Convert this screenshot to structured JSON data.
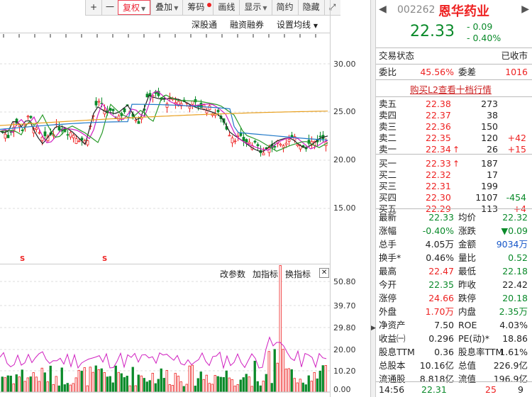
{
  "toolbar": {
    "items": [
      "+",
      "一",
      "复权",
      "叠加",
      "筹码",
      "画线",
      "显示",
      "简约",
      "隐藏"
    ],
    "expand_icon": "expand-icon"
  },
  "subbar": {
    "items": [
      "深股通",
      "融资融券",
      "设置均线"
    ]
  },
  "price_axis": {
    "labels": [
      "30.00",
      "25.00",
      "20.00",
      "15.00"
    ]
  },
  "volume": {
    "toolbar": [
      "改参数",
      "加指标",
      "换指标"
    ],
    "axis_labels": [
      "50.80",
      "39.70",
      "29.80",
      "20.00",
      "10.20",
      "0.00"
    ]
  },
  "markers": [
    "S",
    "S"
  ],
  "stock": {
    "code": "002262",
    "name": "恩华药业",
    "price": "22.33",
    "change": "- 0.09",
    "change_pct": "- 0.40%"
  },
  "status": {
    "label": "交易状态",
    "value": "已收市"
  },
  "ratio": {
    "k1": "委比",
    "v1": "45.56%",
    "k2": "委差",
    "v2": "1016"
  },
  "l2_link": "购买L2查看十档行情",
  "asks": [
    {
      "label": "卖五",
      "price": "22.38",
      "vol": "273",
      "chg": ""
    },
    {
      "label": "卖四",
      "price": "22.37",
      "vol": "38",
      "chg": ""
    },
    {
      "label": "卖三",
      "price": "22.36",
      "vol": "150",
      "chg": ""
    },
    {
      "label": "卖二",
      "price": "22.35",
      "vol": "120",
      "chg": "+42"
    },
    {
      "label": "卖一",
      "price": "22.34",
      "vol": "26",
      "chg": "+15"
    }
  ],
  "bids": [
    {
      "label": "买一",
      "price": "22.33",
      "vol": "187",
      "chg": ""
    },
    {
      "label": "买二",
      "price": "22.32",
      "vol": "17",
      "chg": ""
    },
    {
      "label": "买三",
      "price": "22.31",
      "vol": "199",
      "chg": ""
    },
    {
      "label": "买四",
      "price": "22.30",
      "vol": "1107",
      "chg": "-454"
    },
    {
      "label": "买五",
      "price": "22.29",
      "vol": "113",
      "chg": "+4"
    }
  ],
  "stats": [
    {
      "k1": "最新",
      "v1": "22.33",
      "c1": "green",
      "k2": "均价",
      "v2": "22.32",
      "c2": "green"
    },
    {
      "k1": "涨幅",
      "v1": "-0.40%",
      "c1": "green",
      "k2": "涨跌",
      "v2": "▼0.09",
      "c2": "green"
    },
    {
      "k1": "总手",
      "v1": "4.05万",
      "c1": "",
      "k2": "金额",
      "v2": "9034万",
      "c2": "blue"
    },
    {
      "k1": "换手*",
      "v1": "0.46%",
      "c1": "",
      "k2": "量比",
      "v2": "0.52",
      "c2": "green"
    },
    {
      "k1": "最高",
      "v1": "22.47",
      "c1": "red",
      "k2": "最低",
      "v2": "22.18",
      "c2": "green"
    },
    {
      "k1": "今开",
      "v1": "22.35",
      "c1": "green",
      "k2": "昨收",
      "v2": "22.42",
      "c2": ""
    },
    {
      "k1": "涨停",
      "v1": "24.66",
      "c1": "red",
      "k2": "跌停",
      "v2": "20.18",
      "c2": "green"
    },
    {
      "k1": "外盘",
      "v1": "1.70万",
      "c1": "red",
      "k2": "内盘",
      "v2": "2.35万",
      "c2": "green"
    },
    {
      "k1": "净资产",
      "v1": "7.50",
      "c1": "",
      "k2": "ROE",
      "v2": "4.03%",
      "c2": ""
    },
    {
      "k1": "收益㈠",
      "v1": "0.296",
      "c1": "",
      "k2": "PE(动)*",
      "v2": "18.86",
      "c2": ""
    },
    {
      "k1": "股息TTM",
      "v1": "0.36",
      "c1": "",
      "k2": "股息率TTM",
      "v2": "1.61%",
      "c2": ""
    },
    {
      "k1": "总股本",
      "v1": "10.16亿",
      "c1": "",
      "k2": "总值",
      "v2": "226.9亿",
      "c2": ""
    },
    {
      "k1": "流通股",
      "v1": "8.818亿",
      "c1": "",
      "k2": "流值",
      "v2": "196.9亿",
      "c2": ""
    }
  ],
  "last_trade": {
    "time": "14:56",
    "price": "22.31",
    "vol": "25",
    "count": "9"
  },
  "colors": {
    "up": "#e22222",
    "down": "#0a8a2a",
    "accent": "#e23333"
  }
}
